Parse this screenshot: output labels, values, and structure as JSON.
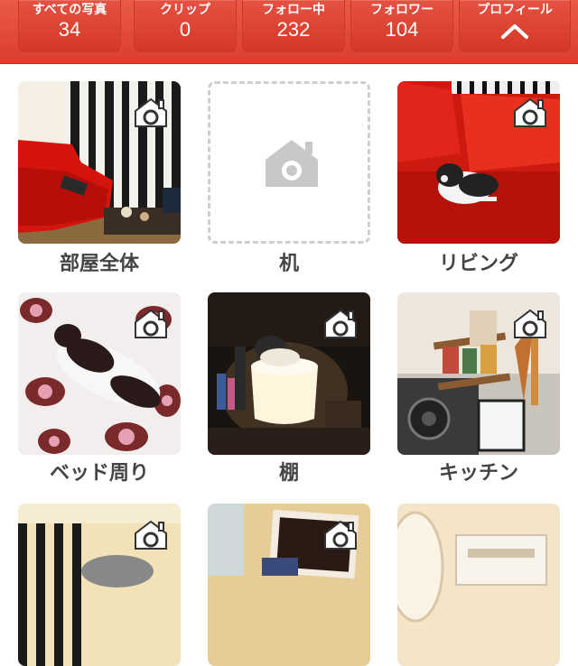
{
  "stats": [
    {
      "label": "すべての写真",
      "value": "34"
    },
    {
      "label": "クリップ",
      "value": "0"
    },
    {
      "label": "フォロー中",
      "value": "232"
    },
    {
      "label": "フォロワー",
      "value": "104"
    },
    {
      "label": "プロフィール",
      "icon": "chevron-up-icon"
    }
  ],
  "rooms": [
    {
      "label": "部屋全体"
    },
    {
      "label": "机"
    },
    {
      "label": "リビング"
    },
    {
      "label": "ベッド周り"
    },
    {
      "label": "棚"
    },
    {
      "label": "キッチン"
    }
  ],
  "colors": {
    "header_red": "#dc3e2c",
    "label_gray": "#444444",
    "placeholder_gray": "#c8c8c8"
  }
}
